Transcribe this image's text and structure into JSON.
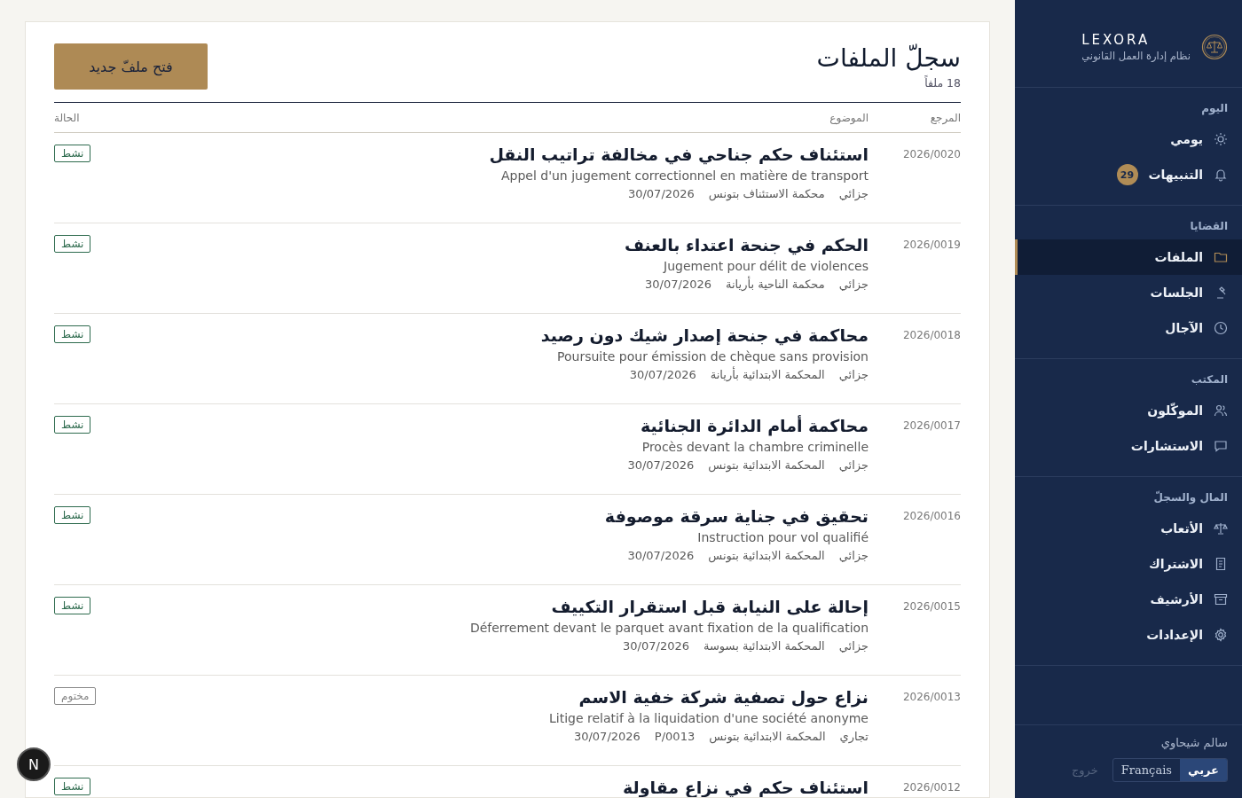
{
  "brand": {
    "name": "LEXORA",
    "tagline": "نظام إدارة العمل القانوني"
  },
  "nav_sections": [
    {
      "title": "اليوم",
      "items": [
        {
          "label": "يومي",
          "selected": false
        },
        {
          "label": "التنبيهات",
          "selected": false,
          "badge": "29"
        }
      ]
    },
    {
      "title": "القضايا",
      "items": [
        {
          "label": "الملفات",
          "selected": true
        },
        {
          "label": "الجلسات",
          "selected": false
        },
        {
          "label": "الآجال",
          "selected": false
        }
      ]
    },
    {
      "title": "المكتب",
      "items": [
        {
          "label": "الموكّلون",
          "selected": false
        },
        {
          "label": "الاستشارات",
          "selected": false
        }
      ]
    },
    {
      "title": "المال والسجلّ",
      "items": [
        {
          "label": "الأتعاب",
          "selected": false
        },
        {
          "label": "الاشتراك",
          "selected": false
        },
        {
          "label": "الأرشيف",
          "selected": false
        },
        {
          "label": "الإعدادات",
          "selected": false
        }
      ]
    }
  ],
  "user": {
    "name": "سالم شيحاوي",
    "languages": [
      {
        "label": "عربي",
        "selected": true
      },
      {
        "label": "Français",
        "selected": false
      }
    ],
    "logout": "خروج"
  },
  "page": {
    "title": "سجلّ الملفات",
    "count": "18 ملفاً",
    "new_button": "فتح ملفّ جديد"
  },
  "table": {
    "columns": [
      "المرجع",
      "الموضوع",
      "الحالة"
    ],
    "rows": [
      {
        "ref": "2026/0020",
        "title": "استئناف حكم جناحي في مخالفة تراتيب النقل",
        "subtitle": "Appel d'un jugement correctionnel en matière de transport",
        "meta": [
          "جزائي",
          "محكمة الاستئناف بتونس",
          "30/07/2026"
        ],
        "status": {
          "label": "نشط",
          "kind": "active"
        }
      },
      {
        "ref": "2026/0019",
        "title": "الحكم في جنحة اعتداء بالعنف",
        "subtitle": "Jugement pour délit de violences",
        "meta": [
          "جزائي",
          "محكمة الناحية بأريانة",
          "30/07/2026"
        ],
        "status": {
          "label": "نشط",
          "kind": "active"
        }
      },
      {
        "ref": "2026/0018",
        "title": "محاكمة في جنحة إصدار شيك دون رصيد",
        "subtitle": "Poursuite pour émission de chèque sans provision",
        "meta": [
          "جزائي",
          "المحكمة الابتدائية بأريانة",
          "30/07/2026"
        ],
        "status": {
          "label": "نشط",
          "kind": "active"
        }
      },
      {
        "ref": "2026/0017",
        "title": "محاكمة أمام الدائرة الجنائية",
        "subtitle": "Procès devant la chambre criminelle",
        "meta": [
          "جزائي",
          "المحكمة الابتدائية بتونس",
          "30/07/2026"
        ],
        "status": {
          "label": "نشط",
          "kind": "active"
        }
      },
      {
        "ref": "2026/0016",
        "title": "تحقيق في جناية سرقة موصوفة",
        "subtitle": "Instruction pour vol qualifié",
        "meta": [
          "جزائي",
          "المحكمة الابتدائية بتونس",
          "30/07/2026"
        ],
        "status": {
          "label": "نشط",
          "kind": "active"
        }
      },
      {
        "ref": "2026/0015",
        "title": "إحالة على النيابة قبل استقرار التكييف",
        "subtitle": "Déferrement devant le parquet avant fixation de la qualification",
        "meta": [
          "جزائي",
          "المحكمة الابتدائية بسوسة",
          "30/07/2026"
        ],
        "status": {
          "label": "نشط",
          "kind": "active"
        }
      },
      {
        "ref": "2026/0013",
        "title": "نزاع حول تصفية شركة خفية الاسم",
        "subtitle": "Litige relatif à la liquidation d'une société anonyme",
        "meta": [
          "تجاري",
          "المحكمة الابتدائية بتونس",
          "0013/P",
          "30/07/2026"
        ],
        "status": {
          "label": "مختوم",
          "kind": "closed"
        }
      },
      {
        "ref": "2026/0012",
        "title": "استئناف حكم في نزاع مقاولة",
        "status": {
          "label": "نشط",
          "kind": "active"
        }
      }
    ]
  },
  "dev_button": {
    "label": "N"
  }
}
